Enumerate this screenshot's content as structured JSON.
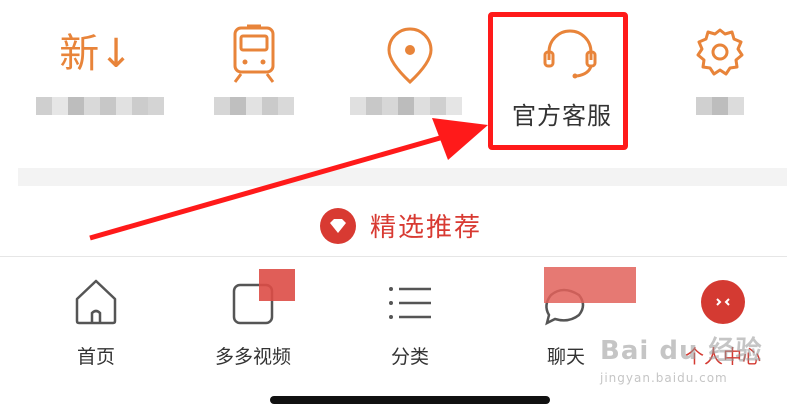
{
  "top_grid": {
    "items": [
      {
        "id": "new",
        "icon": "new-arrival-icon",
        "label_visible": false
      },
      {
        "id": "train",
        "icon": "train-icon",
        "label_visible": false
      },
      {
        "id": "location",
        "icon": "location-pin-icon",
        "label_visible": false
      },
      {
        "id": "service",
        "icon": "headset-icon",
        "label": "官方客服"
      },
      {
        "id": "settings",
        "icon": "gear-icon",
        "label_visible": false
      }
    ],
    "new_icon_glyph": "新↓"
  },
  "section": {
    "title": "精选推荐",
    "icon": "heart-badge-icon"
  },
  "bottom_nav": {
    "items": [
      {
        "label": "首页",
        "icon": "home-icon"
      },
      {
        "label": "多多视频",
        "icon": "video-icon"
      },
      {
        "label": "分类",
        "icon": "list-icon"
      },
      {
        "label": "聊天",
        "icon": "chat-icon"
      },
      {
        "label": "个人中心",
        "icon": "profile-badge-icon",
        "active": true
      }
    ]
  },
  "watermark": {
    "brand": "Bai du 经验",
    "sub": "jingyan.baidu.com"
  },
  "colors": {
    "accent_orange": "#e8843a",
    "accent_red": "#d43a32",
    "highlight_red": "#ff1a1a"
  }
}
